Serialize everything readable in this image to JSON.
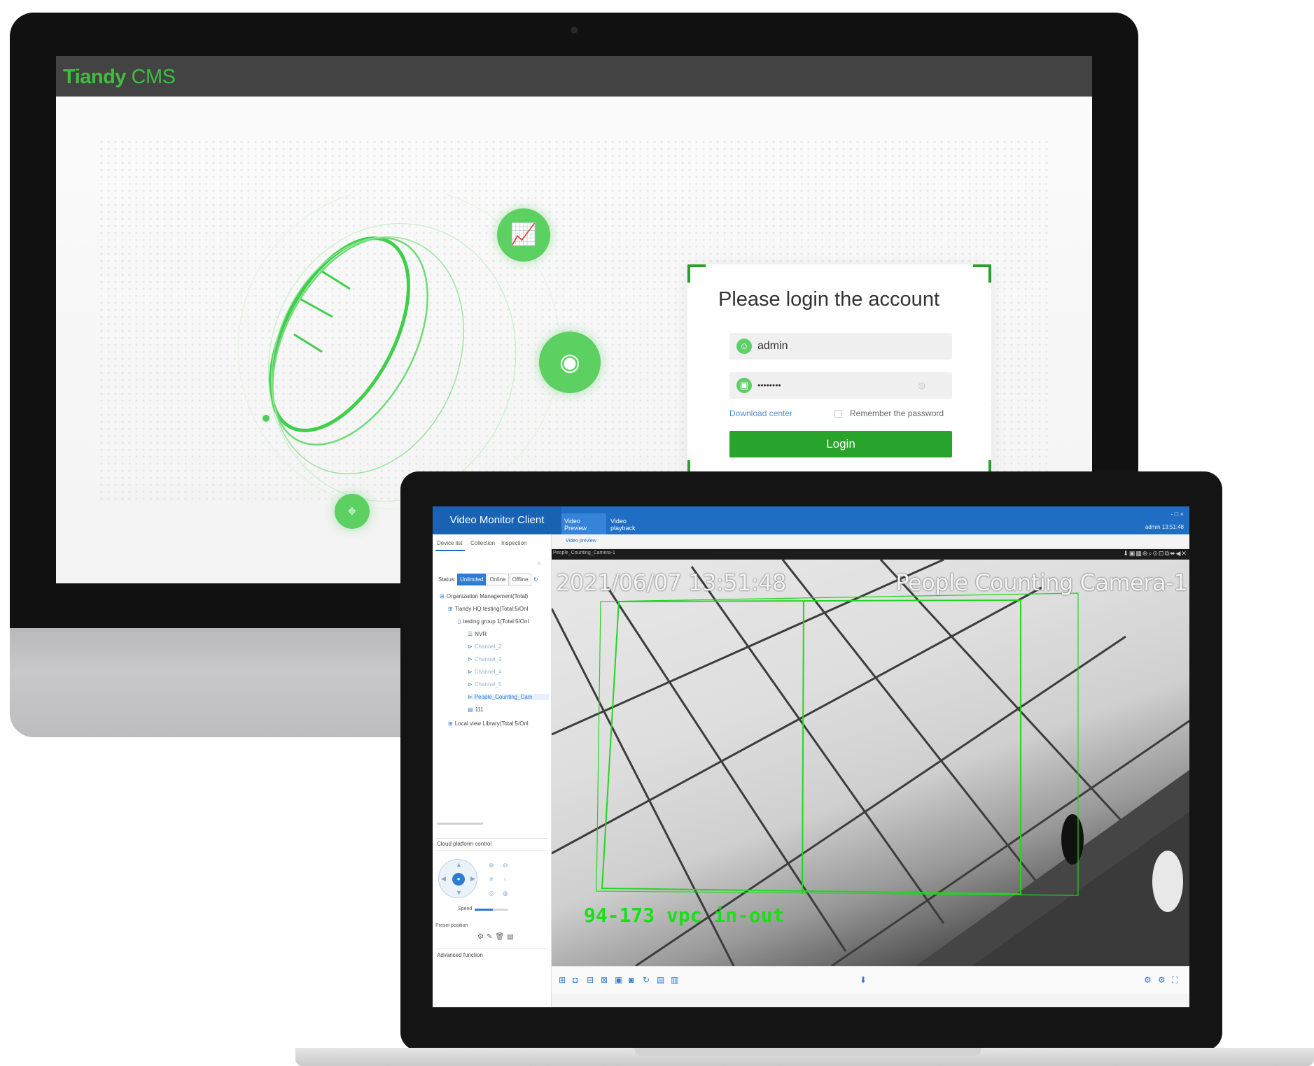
{
  "cms": {
    "logo_brand": "Tiandy",
    "logo_product": "CMS",
    "login": {
      "title": "Please login the account",
      "username_value": "admin",
      "password_value": "••••••••",
      "download_link": "Download center",
      "remember_label": "Remember the password",
      "login_button": "Login"
    },
    "icons": [
      "chart-monitor-icon",
      "camera-icon",
      "map-pin-icon"
    ]
  },
  "client": {
    "app_title": "Video Monitor Client",
    "tabs": [
      "Video Preview",
      "Video playback"
    ],
    "window_controls": "- □ ×",
    "user_time": "admin 13:51:48",
    "side_tabs": [
      "Device list",
      "Collection",
      "Inspection"
    ],
    "status_label": "Status:",
    "status_filters": [
      "Unlimited",
      "Online",
      "Offline"
    ],
    "tree": [
      "Organization Management(Total)",
      "Tiandy HQ testing(Total:5/Onl",
      "testing group 1(Total:5/Onl",
      "NVR",
      "Channel_2",
      "Channel_3",
      "Channel_4",
      "Channel_5",
      "People_Counting_Cam",
      "111",
      "Local view Library(Total:5/Onl"
    ],
    "ptz_section": "Cloud platform control",
    "speed_label": "Speed",
    "speed_level": 0.55,
    "preset_label": "Preset position",
    "advanced_section": "Advanced function",
    "preview_tab": "Video preview",
    "video": {
      "channel_title": "People_Counting_Camera-1",
      "osd_time": "2021/06/07 13:51:48",
      "osd_camera": "People Counting Camera-1",
      "osd_count": "94-173   vpc in-out"
    }
  },
  "colors": {
    "brand_green": "#28a32c",
    "client_blue": "#1f6ec4",
    "osd_green": "#18e018"
  }
}
